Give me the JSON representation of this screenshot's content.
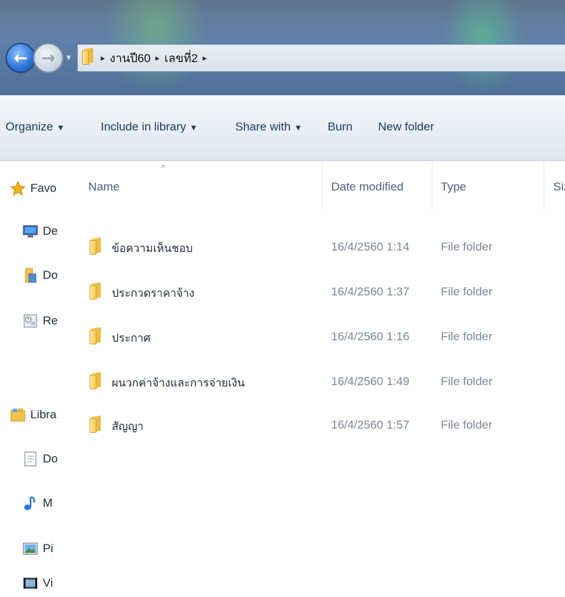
{
  "address_bar": {
    "breadcrumbs": [
      "งานปี60",
      "เลขที่2"
    ],
    "separator": "▸"
  },
  "toolbar": {
    "organize": "Organize",
    "include_in_library": "Include in library",
    "share_with": "Share with",
    "burn": "Burn",
    "new_folder": "New folder"
  },
  "nav_pane": {
    "favorites": {
      "label": "Favo",
      "icon": "star-icon"
    },
    "items": [
      {
        "label": "De",
        "icon": "desktop-icon"
      },
      {
        "label": "Do",
        "icon": "downloads-folder-icon"
      },
      {
        "label": "Re",
        "icon": "recent-places-icon"
      }
    ],
    "libraries": {
      "label": "Libra",
      "icon": "libraries-icon"
    },
    "library_items": [
      {
        "label": "Do",
        "icon": "documents-icon"
      },
      {
        "label": "M",
        "icon": "music-icon"
      },
      {
        "label": "Pi",
        "icon": "pictures-icon"
      },
      {
        "label": "Vi",
        "icon": "videos-icon"
      }
    ]
  },
  "columns": {
    "name": "Name",
    "date_modified": "Date modified",
    "type": "Type",
    "size": "Siz"
  },
  "files": [
    {
      "name": "ข้อความเห็นชอบ",
      "date": "16/4/2560 1:14",
      "type": "File folder"
    },
    {
      "name": "ประกวดราคาจ้าง",
      "date": "16/4/2560 1:37",
      "type": "File folder"
    },
    {
      "name": "ประกาศ",
      "date": "16/4/2560 1:16",
      "type": "File folder"
    },
    {
      "name": "ผนวกค่าจ้างและการจ่ายเงิน",
      "date": "16/4/2560 1:49",
      "type": "File folder"
    },
    {
      "name": "สัญญา",
      "date": "16/4/2560 1:57",
      "type": "File folder"
    }
  ]
}
